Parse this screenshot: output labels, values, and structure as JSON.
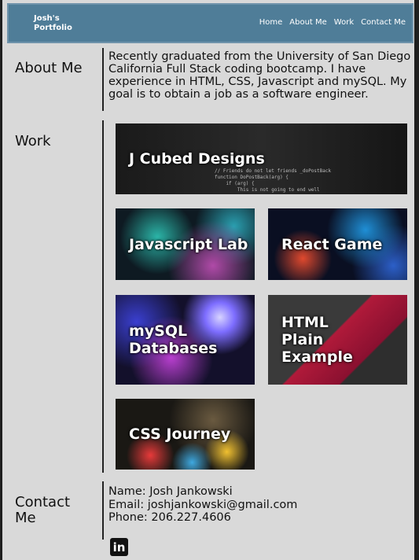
{
  "nav": {
    "brand": "Josh's Portfolio",
    "links": [
      "Home",
      "About Me",
      "Work",
      "Contact Me"
    ]
  },
  "about": {
    "title": "About Me",
    "text": "Recently graduated from the University of San Diego California Full Stack coding bootcamp. I have experience in HTML, CSS, Javascript and mySQL. My goal is to obtain a job as a software engineer."
  },
  "work": {
    "title": "Work",
    "cards": [
      {
        "label": "J Cubed Designs"
      },
      {
        "label": "Javascript Lab"
      },
      {
        "label": "React Game"
      },
      {
        "label": "mySQL Databases"
      },
      {
        "label": "HTML Plain Example"
      },
      {
        "label": "CSS Journey"
      }
    ],
    "code_snippet": "// Friends do not let friends _doPostBack\nfunction DoPostBack(arg) {\n    if (arg) {\n        This is not going to end well"
  },
  "contact": {
    "title": "Contact Me",
    "name": "Name: Josh Jankowski",
    "email": "Email: joshjankowski@gmail.com",
    "phone": "Phone: 206.227.4606",
    "linkedin_icon": "in"
  }
}
